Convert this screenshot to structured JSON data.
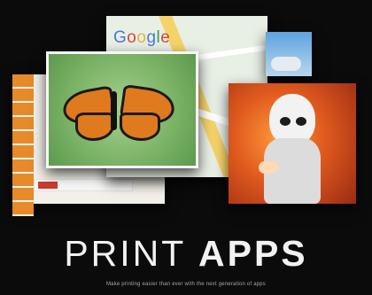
{
  "map": {
    "logo_text": "Google"
  },
  "heading": {
    "light": "PRINT",
    "bold": "APPS"
  },
  "tagline": "Make printing easier than ever with the next generation of apps"
}
